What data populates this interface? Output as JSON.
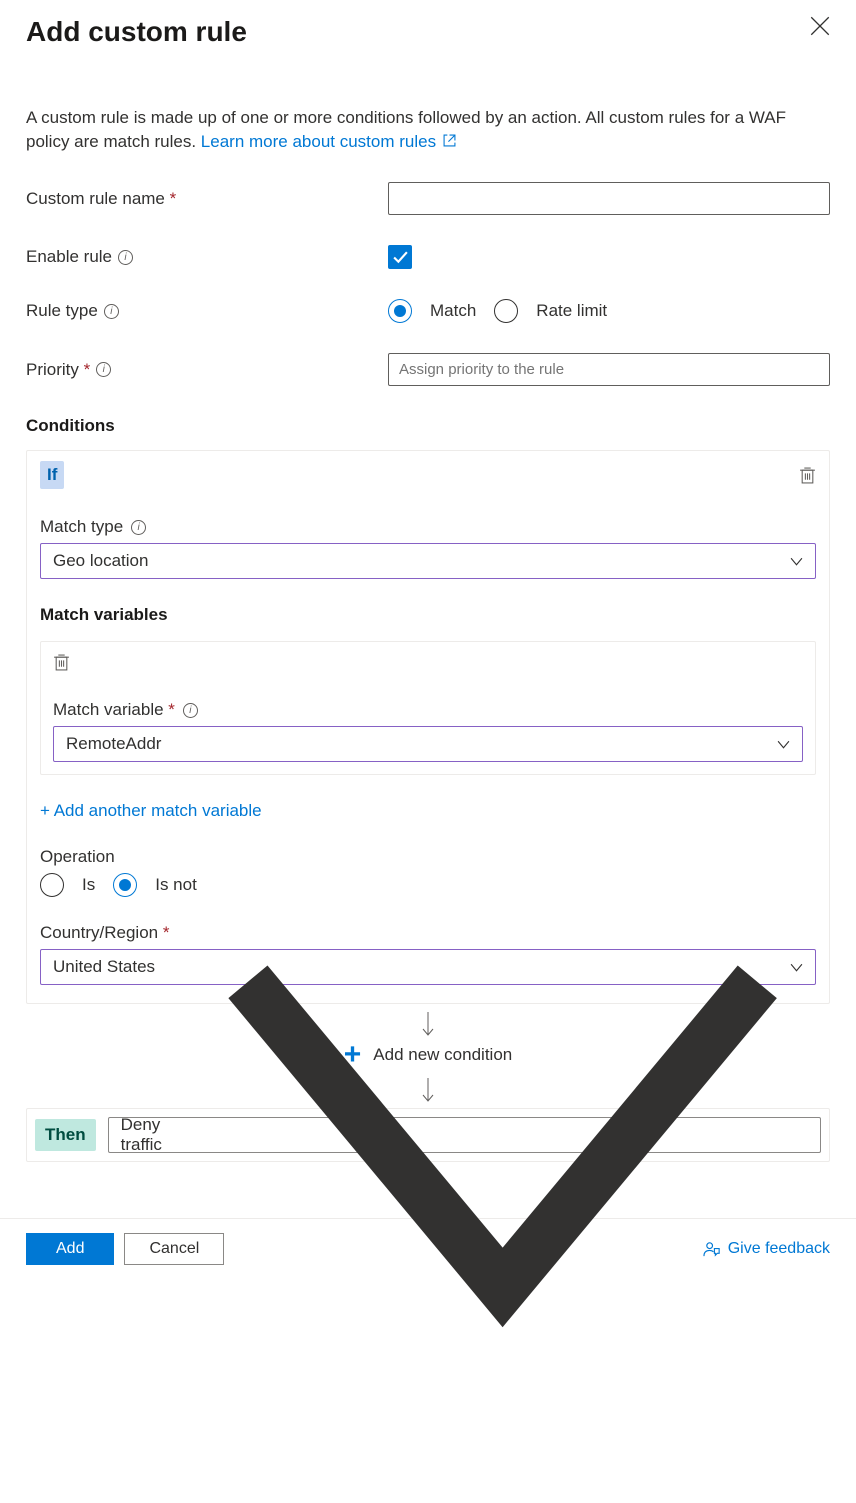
{
  "header": {
    "title": "Add custom rule"
  },
  "description": {
    "text": "A custom rule is made up of one or more conditions followed by an action. All custom rules for a WAF policy are match rules. ",
    "link_text": "Learn more about custom rules"
  },
  "form": {
    "name_label": "Custom rule name",
    "name_value": "",
    "enable_label": "Enable rule",
    "rule_type_label": "Rule type",
    "rule_type_options": {
      "match": "Match",
      "rate_limit": "Rate limit"
    },
    "priority_label": "Priority",
    "priority_placeholder": "Assign priority to the rule"
  },
  "conditions": {
    "header": "Conditions",
    "if_badge": "If",
    "match_type_label": "Match type",
    "match_type_value": "Geo location",
    "match_variables_header": "Match variables",
    "match_variable_label": "Match variable",
    "match_variable_value": "RemoteAddr",
    "add_match_variable": "+ Add another match variable",
    "operation_label": "Operation",
    "operation_options": {
      "is": "Is",
      "is_not": "Is not"
    },
    "country_label": "Country/Region",
    "country_value": "United States",
    "add_condition": "Add new condition"
  },
  "then": {
    "badge": "Then",
    "action_value": "Deny traffic"
  },
  "footer": {
    "add": "Add",
    "cancel": "Cancel",
    "feedback": "Give feedback"
  }
}
